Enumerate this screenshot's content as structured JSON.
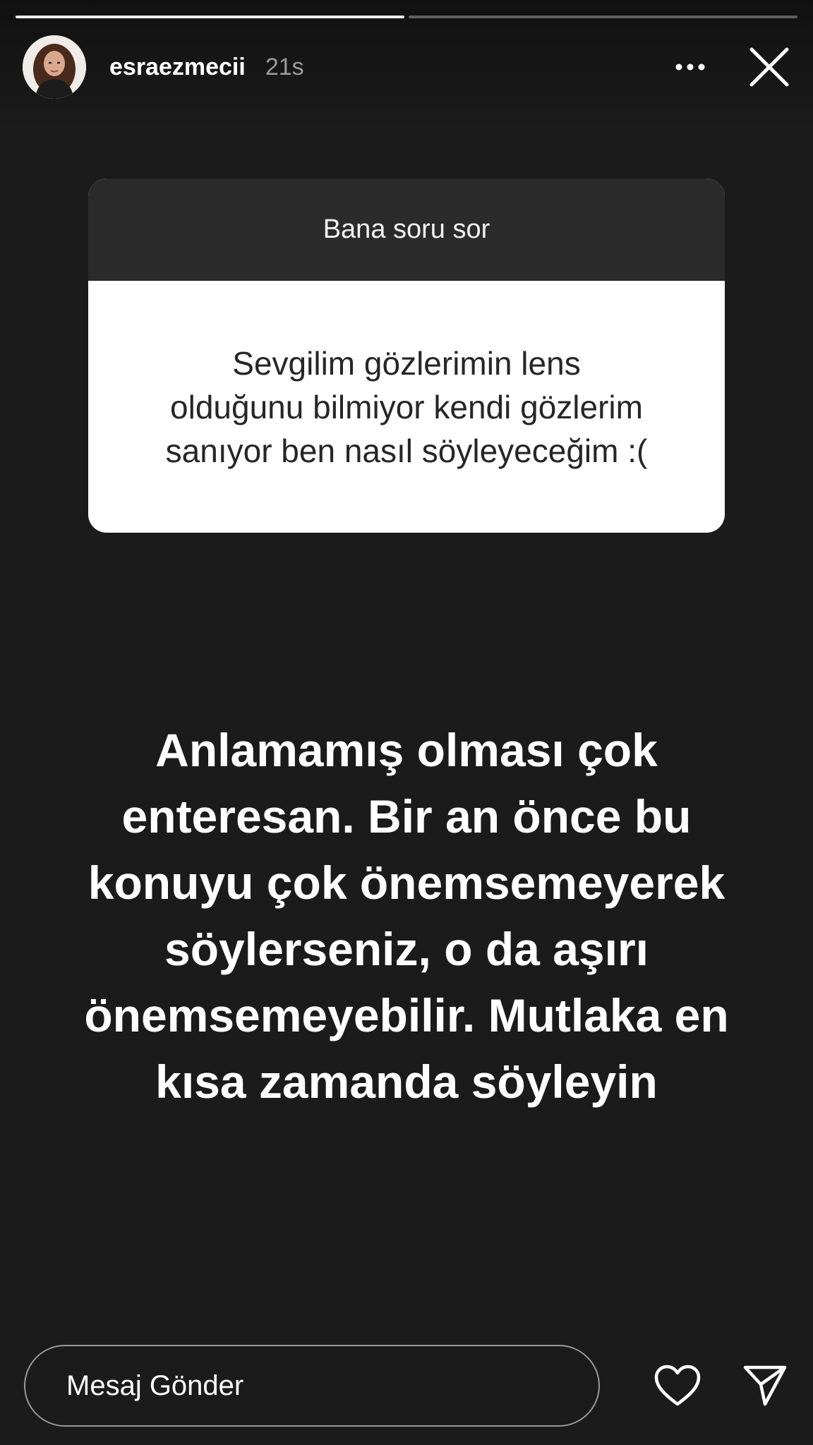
{
  "story": {
    "segments_total": 2,
    "segments_completed": 1
  },
  "header": {
    "username": "esraezmecii",
    "time_ago": "21s",
    "avatar_icon": "profile-avatar",
    "more_icon": "more-dots-icon",
    "close_icon": "close-icon"
  },
  "sticker": {
    "title": "Bana soru sor",
    "question": "Sevgilim gözlerimin lens\nolduğunu bilmiyor kendi gözlerim\nsanıyor ben nasıl söyleyeceğim :("
  },
  "answer": {
    "text": "Anlamamış olması çok\nenteresan. Bir an önce bu\nkonuyu çok önemsemeyerek\nsöylerseniz,  o da aşırı\nönemsemeyebilir. Mutlaka en\nkısa zamanda söyleyin"
  },
  "footer": {
    "message_placeholder": "Mesaj Gönder",
    "heart_icon": "heart-icon",
    "send_icon": "send-icon"
  },
  "colors": {
    "background": "#1b1b1b",
    "sticker_header": "#2b2b2b",
    "timestamp": "#9c9c9c"
  }
}
